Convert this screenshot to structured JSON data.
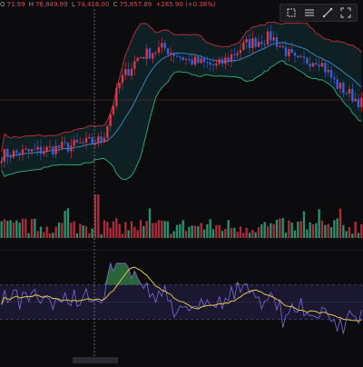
{
  "ohlc_readout": {
    "open_label": "O",
    "open": "71.99",
    "high_label": "H",
    "high": "76,849.99",
    "low_label": "L",
    "low": "74,416.00",
    "close_label": "C",
    "close": "75,857.89",
    "change": "+285.90 (+0.38%)"
  },
  "toolbar": {
    "tools": [
      {
        "name": "select-tool-icon"
      },
      {
        "name": "horizontal-lines-tool-icon"
      },
      {
        "name": "trend-line-tool-icon"
      },
      {
        "name": "fullscreen-tool-icon"
      }
    ]
  },
  "colors": {
    "background": "#0c0c0f",
    "candle_up": "#e0364a",
    "candle_down": "#3a5ee0",
    "bollinger_upper": "#c0303c",
    "bollinger_lower": "#2fb07a",
    "bollinger_mid": "#3a8fd0",
    "bollinger_fill": "#0f2a2e",
    "volume_up": "#c0303c",
    "volume_down": "#2e9e78",
    "osc_line": "#7f6ad8",
    "osc_signal": "#e3c74a",
    "osc_band_fill": "#1a1730",
    "crosshair": "#8a8a8a",
    "ref_line": "#5a2424"
  },
  "chart_data": {
    "type": "candlestick",
    "panes": [
      "price",
      "volume",
      "oscillator"
    ],
    "indicators": [
      "Bollinger Bands",
      "Volume",
      "Oscillator with signal line"
    ],
    "price_range": [
      0,
      100
    ],
    "price_trend": [
      [
        0,
        22
      ],
      [
        10,
        24
      ],
      [
        20,
        27
      ],
      [
        28,
        30
      ],
      [
        33,
        62
      ],
      [
        38,
        75
      ],
      [
        45,
        80
      ],
      [
        52,
        73
      ],
      [
        60,
        70
      ],
      [
        68,
        82
      ],
      [
        75,
        86
      ],
      [
        82,
        72
      ],
      [
        88,
        74
      ],
      [
        93,
        60
      ],
      [
        100,
        50
      ]
    ],
    "oscillator_range": [
      0,
      100
    ],
    "oscillator_band": [
      30,
      70
    ],
    "grid": false,
    "legend": "none"
  }
}
